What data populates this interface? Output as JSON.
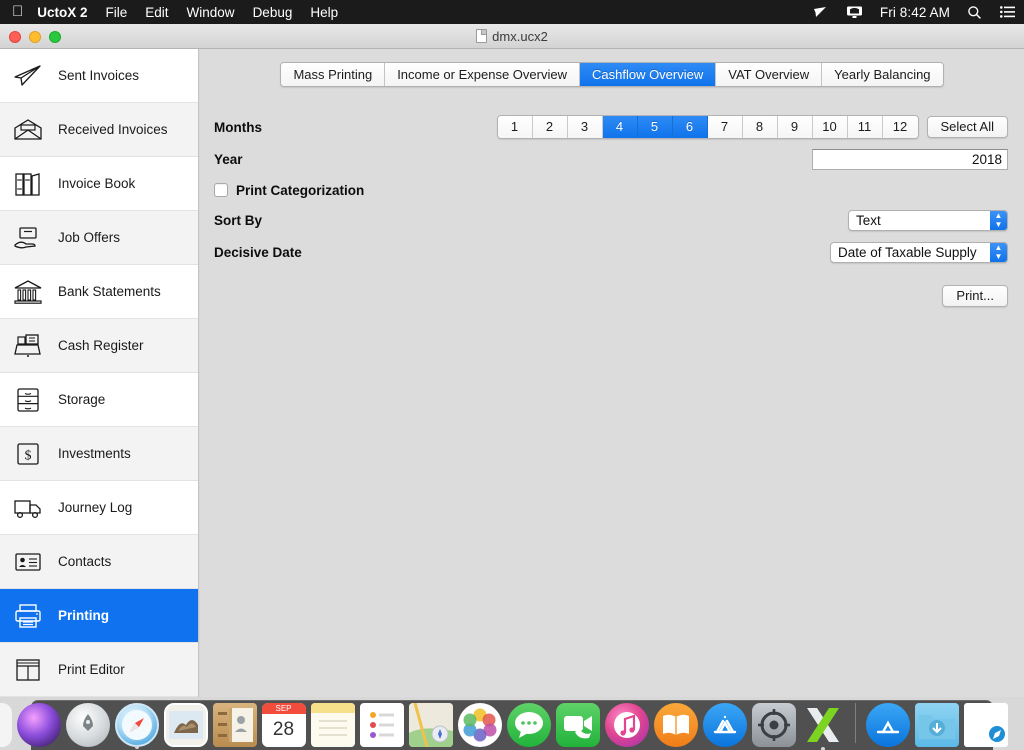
{
  "menubar": {
    "apple_icon": "apple-icon",
    "app_title": "UctoX 2",
    "items": [
      "File",
      "Edit",
      "Window",
      "Debug",
      "Help"
    ],
    "status_icons": [
      "airplay-icon",
      "screen-sharing-icon"
    ],
    "clock": "Fri 8:42 AM",
    "search_icon": "search-icon",
    "notification_icon": "notification-center-icon"
  },
  "window": {
    "title": "dmx.ucx2",
    "document_icon": "document-icon",
    "close_label": "close",
    "minimize_label": "minimize",
    "zoom_label": "zoom"
  },
  "sidebar": {
    "items": [
      {
        "label": "Sent Invoices",
        "icon": "paper-plane-icon",
        "selected": false
      },
      {
        "label": "Received Invoices",
        "icon": "open-envelope-icon",
        "selected": false
      },
      {
        "label": "Invoice Book",
        "icon": "books-icon",
        "selected": false
      },
      {
        "label": "Job Offers",
        "icon": "hand-offer-icon",
        "selected": false
      },
      {
        "label": "Bank Statements",
        "icon": "bank-icon",
        "selected": false
      },
      {
        "label": "Cash Register",
        "icon": "cash-register-icon",
        "selected": false
      },
      {
        "label": "Storage",
        "icon": "drawers-icon",
        "selected": false
      },
      {
        "label": "Investments",
        "icon": "dollar-box-icon",
        "selected": false
      },
      {
        "label": "Journey Log",
        "icon": "truck-icon",
        "selected": false
      },
      {
        "label": "Contacts",
        "icon": "contact-card-icon",
        "selected": false
      },
      {
        "label": "Printing",
        "icon": "printer-icon",
        "selected": true
      },
      {
        "label": "Print Editor",
        "icon": "layout-editor-icon",
        "selected": false
      }
    ]
  },
  "main": {
    "tabs": [
      {
        "label": "Mass Printing",
        "active": false
      },
      {
        "label": "Income or Expense Overview",
        "active": false
      },
      {
        "label": "Cashflow Overview",
        "active": true
      },
      {
        "label": "VAT Overview",
        "active": false
      },
      {
        "label": "Yearly Balancing",
        "active": false
      }
    ],
    "months": {
      "label": "Months",
      "values": [
        "1",
        "2",
        "3",
        "4",
        "5",
        "6",
        "7",
        "8",
        "9",
        "10",
        "11",
        "12"
      ],
      "selected": [
        "4",
        "5",
        "6"
      ],
      "select_all_label": "Select All"
    },
    "year": {
      "label": "Year",
      "value": "2018"
    },
    "print_categorization": {
      "label": "Print Categorization",
      "checked": false
    },
    "sort_by": {
      "label": "Sort By",
      "value": "Text"
    },
    "decisive_date": {
      "label": "Decisive Date",
      "value": "Date of Taxable Supply"
    },
    "print_button": {
      "label": "Print..."
    }
  },
  "colors": {
    "accent_blue": "#1072ef",
    "selected_tab_blue": "#0f73eb",
    "sidebar_bg": "#ffffff",
    "content_bg": "#dcdcdc",
    "menubar_bg": "#1b1b1b"
  },
  "dock": {
    "calendar_month": "SEP",
    "calendar_day": "28",
    "items": [
      "finder-icon",
      "siri-icon",
      "launchpad-icon",
      "safari-icon",
      "mail-icon",
      "contacts-icon",
      "calendar-icon",
      "notes-icon",
      "reminders-icon",
      "maps-icon",
      "photos-icon",
      "messages-icon",
      "facetime-icon",
      "itunes-icon",
      "ibooks-icon",
      "app-store-icon",
      "app-store-2-icon",
      "system-preferences-icon",
      "xcode-icon",
      "separator",
      "app-store-3-icon",
      "downloads-folder-icon",
      "safari-document-icon",
      "trash-icon"
    ]
  }
}
